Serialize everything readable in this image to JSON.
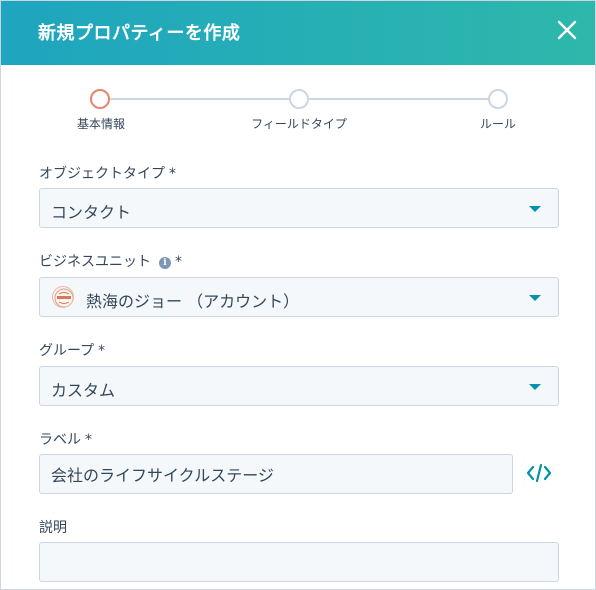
{
  "modal": {
    "title": "新規プロパティーを作成",
    "close_icon": "close-icon"
  },
  "steps": [
    {
      "label": "基本情報",
      "state": "active"
    },
    {
      "label": "フィールドタイプ",
      "state": "pending"
    },
    {
      "label": "ルール",
      "state": "pending"
    }
  ],
  "form": {
    "object_type": {
      "label": "オブジェクトタイプ",
      "required": "*",
      "value": "コンタクト"
    },
    "business_unit": {
      "label": "ビジネスユニット",
      "info_icon": "i",
      "required": "*",
      "value": "熱海のジョー （アカウント）",
      "logo_icon": "business-unit-logo-icon"
    },
    "group": {
      "label": "グループ",
      "required": "*",
      "value": "カスタム"
    },
    "label_field": {
      "label": "ラベル",
      "required": "*",
      "value": "会社のライフサイクルステージ",
      "code_icon": "code-icon"
    },
    "description": {
      "label": "説明",
      "value": ""
    }
  },
  "colors": {
    "accent": "#0091ae",
    "header_start": "#1ea5bf",
    "header_end": "#2eb8ab",
    "active_step": "#e8846c"
  }
}
